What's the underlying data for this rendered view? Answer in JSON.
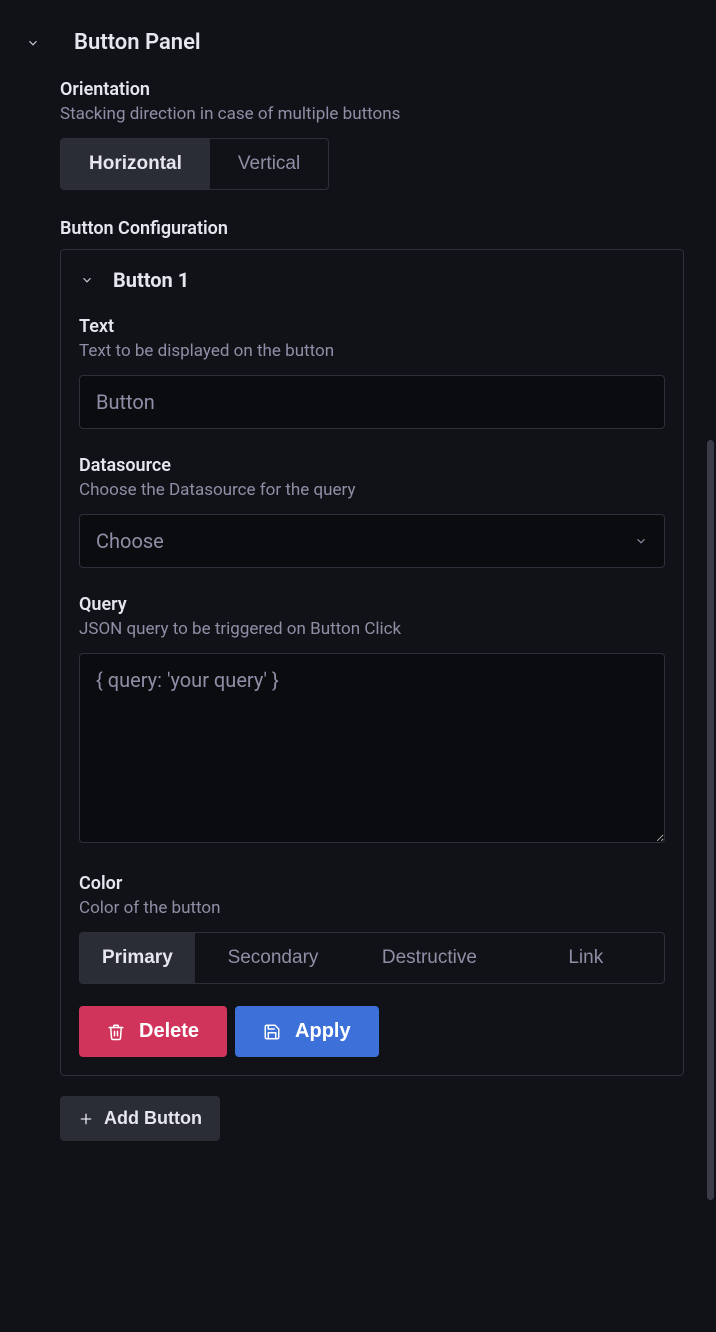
{
  "panel": {
    "title": "Button Panel"
  },
  "orientation": {
    "label": "Orientation",
    "description": "Stacking direction in case of multiple buttons",
    "options": [
      "Horizontal",
      "Vertical"
    ],
    "selected": "Horizontal"
  },
  "configSection": {
    "label": "Button Configuration"
  },
  "button1": {
    "title": "Button 1",
    "text": {
      "label": "Text",
      "description": "Text to be displayed on the button",
      "value": "Button"
    },
    "datasource": {
      "label": "Datasource",
      "description": "Choose the Datasource for the query",
      "placeholder": "Choose"
    },
    "query": {
      "label": "Query",
      "description": "JSON query to be triggered on Button Click",
      "value": "{ query: 'your query' }"
    },
    "color": {
      "label": "Color",
      "description": "Color of the button",
      "options": [
        "Primary",
        "Secondary",
        "Destructive",
        "Link"
      ],
      "selected": "Primary"
    },
    "actions": {
      "delete": "Delete",
      "apply": "Apply"
    }
  },
  "addButton": {
    "label": "Add Button"
  }
}
